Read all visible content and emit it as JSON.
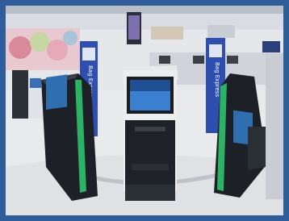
{
  "photo": {
    "subject": "self-service-kiosks-airport-terminal",
    "frame_color": "#2f5d9a",
    "accent_green": "#2ecc71",
    "banner_blue": "#2f4fb0"
  },
  "banners": {
    "left_text": "Bag Express",
    "right_text": "Bag Express"
  }
}
